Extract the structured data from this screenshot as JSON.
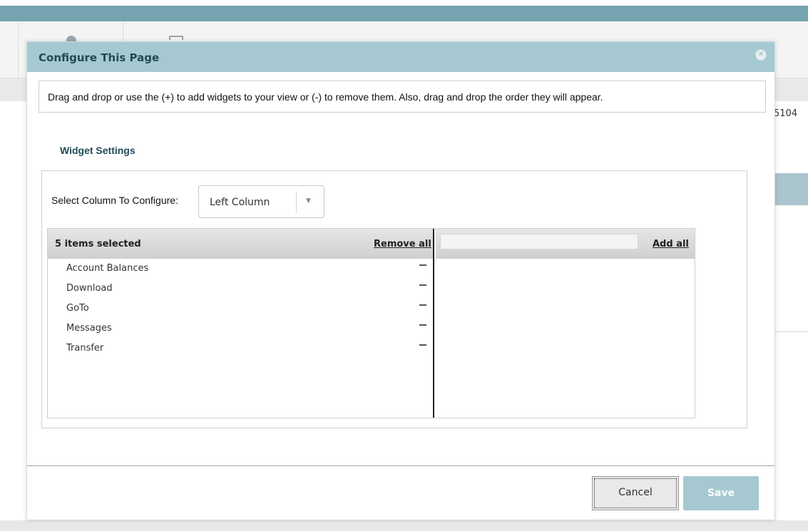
{
  "background": {
    "partial_number": "5104"
  },
  "modal": {
    "title": "Configure This Page",
    "close_icon": "close-icon",
    "instruction": "Drag and drop or use the (+) to add widgets to your view or (-) to remove them. Also, drag and drop the order they will appear.",
    "section_title": "Widget Settings",
    "column_select": {
      "label": "Select Column To Configure:",
      "value": "Left Column"
    },
    "selected_list": {
      "count_label": "5 items selected",
      "remove_all_label": "Remove all",
      "items": [
        {
          "label": "Account Balances"
        },
        {
          "label": "Download"
        },
        {
          "label": "GoTo"
        },
        {
          "label": "Messages"
        },
        {
          "label": "Transfer"
        }
      ]
    },
    "available_list": {
      "search_value": "",
      "add_all_label": "Add all"
    },
    "buttons": {
      "cancel": "Cancel",
      "save": "Save"
    }
  },
  "colors": {
    "header_bar": "#76a3b0",
    "modal_header": "#a6c9d1",
    "title_text": "#1f4a57",
    "save_button": "#a6c9d1"
  }
}
